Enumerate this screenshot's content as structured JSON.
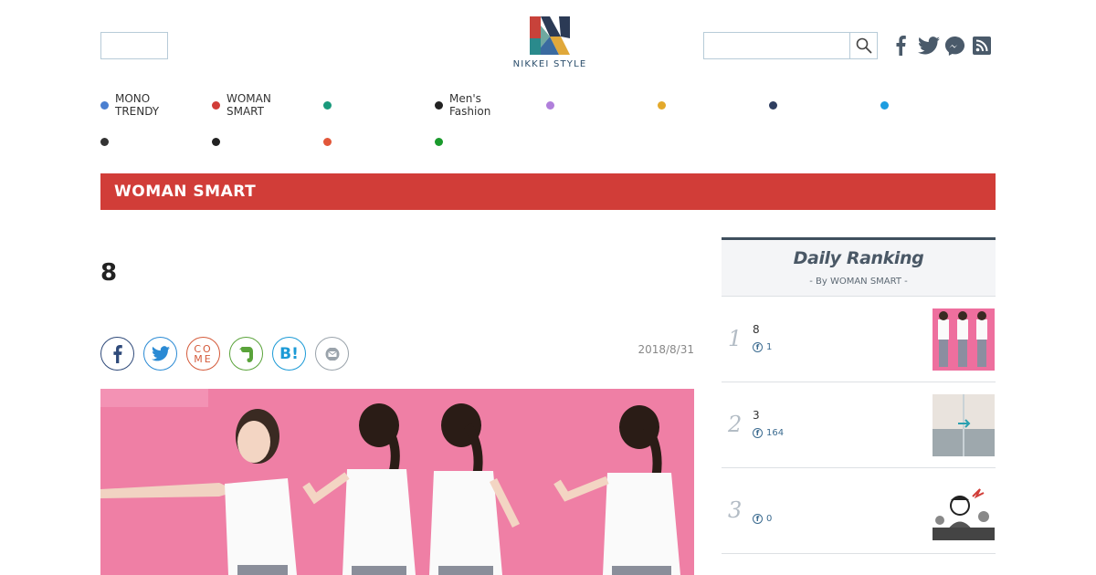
{
  "header": {
    "logo_text": "NIKKEI STYLE",
    "social": [
      "facebook-icon",
      "twitter-icon",
      "messenger-icon",
      "rss-icon"
    ]
  },
  "nav": {
    "row1": [
      {
        "label": "MONO\nTRENDY",
        "color": "#4a7fd0"
      },
      {
        "label": "WOMAN\nSMART",
        "color": "#d13d38"
      },
      {
        "label": "",
        "color": "#1a9a7c"
      },
      {
        "label": "Men's\nFashion",
        "color": "#222222"
      },
      {
        "label": "",
        "color": "#b07fdb"
      },
      {
        "label": "",
        "color": "#e3a92b"
      },
      {
        "label": "",
        "color": "#2f3e60"
      },
      {
        "label": "",
        "color": "#1d9de0"
      }
    ],
    "row2": [
      {
        "label": "",
        "color": "#333333"
      },
      {
        "label": "",
        "color": "#222222"
      },
      {
        "label": "",
        "color": "#e2573a"
      },
      {
        "label": "",
        "color": "#1a9a2c"
      }
    ]
  },
  "banner": {
    "title": "WOMAN SMART",
    "color": "#d13d38"
  },
  "article": {
    "headline": "8",
    "date": "2018/8/31",
    "share_buttons": [
      "facebook-share",
      "twitter-share",
      "come-share",
      "evernote-share",
      "hatena-bookmark-share",
      "mail-share"
    ],
    "come_label_top": "CO",
    "come_label_bottom": "ME",
    "hatena_label": "B!"
  },
  "ranking": {
    "title": "Daily Ranking",
    "subtitle": "- By WOMAN SMART -",
    "items": [
      {
        "rank": "1",
        "title": "8",
        "count": "1"
      },
      {
        "rank": "2",
        "title": "3",
        "count": "164"
      },
      {
        "rank": "3",
        "title": "",
        "count": "0"
      }
    ]
  }
}
